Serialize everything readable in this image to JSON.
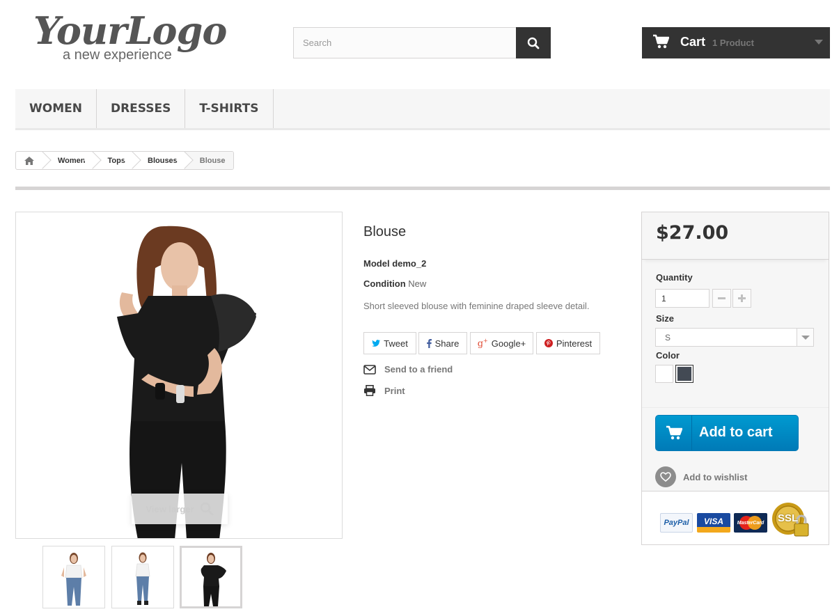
{
  "header": {
    "logo_script": "YourLogo",
    "logo_tagline": "a new experience",
    "search_placeholder": "Search",
    "cart_label": "Cart",
    "cart_count": "1 Product"
  },
  "menu": {
    "items": [
      {
        "label": "WOMEN"
      },
      {
        "label": "DRESSES"
      },
      {
        "label": "T-SHIRTS"
      }
    ]
  },
  "breadcrumb": {
    "items": [
      "Women",
      "Tops",
      "Blouses",
      "Blouse"
    ]
  },
  "product": {
    "view_larger": "View larger",
    "title": "Blouse",
    "model_label": "Model",
    "model_value": "demo_2",
    "condition_label": "Condition",
    "condition_value": "New",
    "description": "Short sleeved blouse with feminine draped sleeve detail.",
    "social": {
      "tweet": "Tweet",
      "share": "Share",
      "google": "Google+",
      "pinterest": "Pinterest"
    },
    "send_to_friend": "Send to a friend",
    "print": "Print"
  },
  "buy_box": {
    "price": "$27.00",
    "quantity_label": "Quantity",
    "quantity_value": "1",
    "size_label": "Size",
    "size_value": "S",
    "color_label": "Color",
    "colors": [
      "#ffffff",
      "#434a54"
    ],
    "add_to_cart": "Add to cart",
    "add_to_wishlist": "Add to wishlist",
    "payments": {
      "paypal": "PayPal",
      "visa": "VISA",
      "mastercard": "MasterCard",
      "ssl": "SSL"
    }
  },
  "colors": {
    "accent_blue": "#0a8ac7",
    "dark": "#333333",
    "twitter": "#00aaf0",
    "facebook": "#435f9f",
    "google": "#e04b34",
    "pinterest": "#ce1f21"
  }
}
